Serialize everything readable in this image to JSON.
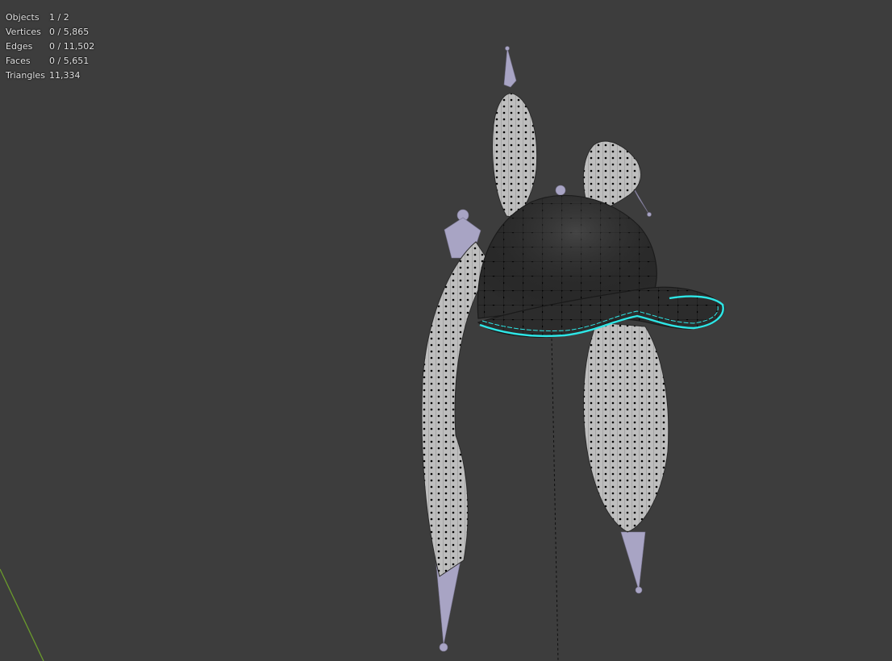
{
  "stats": {
    "objects": {
      "label": "Objects",
      "value": "1 / 2"
    },
    "vertices": {
      "label": "Vertices",
      "value": "0 / 5,865"
    },
    "edges": {
      "label": "Edges",
      "value": "0 / 11,502"
    },
    "faces": {
      "label": "Faces",
      "value": "0 / 5,651"
    },
    "triangles": {
      "label": "Triangles",
      "value": "11,334"
    }
  },
  "colors": {
    "viewport_background": "#3d3d3d",
    "mesh_fill": "#b9b9b9",
    "cap_fill": "#2f2f2f",
    "vertex": "#000000",
    "selected_edge": "#2ee6e6",
    "bone": "#a8a4c4",
    "axis_y": "#6a9b2c"
  }
}
